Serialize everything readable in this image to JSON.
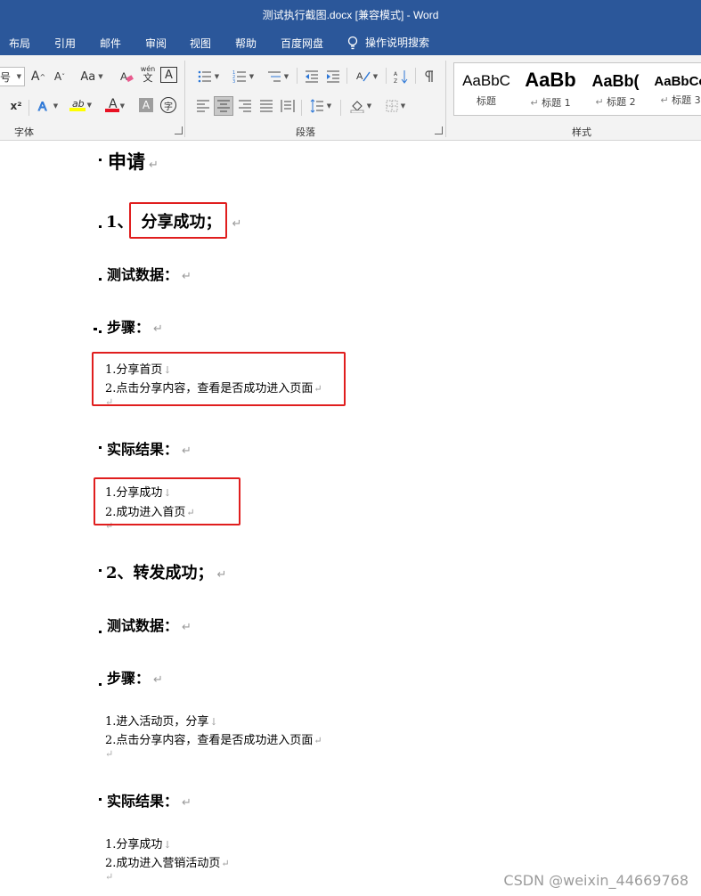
{
  "window": {
    "title": "测试执行截图.docx [兼容模式]  -  Word"
  },
  "menu": {
    "tabs": [
      "布局",
      "引用",
      "邮件",
      "审阅",
      "视图",
      "帮助",
      "百度网盘"
    ],
    "tell_me": "操作说明搜索"
  },
  "ribbon": {
    "font_size_value": "号",
    "grow_font": "A",
    "shrink_font": "A",
    "change_case": "Aa",
    "phonetic_top": "wén",
    "phonetic_bottom": "文",
    "border_char": "A",
    "superscript": "x²",
    "highlight": "ab",
    "font_color": "A",
    "shade_char": "A",
    "enclose_char": "字",
    "groups": {
      "font": "字体",
      "paragraph": "段落",
      "styles": "样式"
    },
    "styles": [
      {
        "sample": "AaBbC",
        "name": "标题"
      },
      {
        "sample": "AaBb",
        "name": "标题 1"
      },
      {
        "sample": "AaBb(",
        "name": "标题 2"
      },
      {
        "sample": "AaBbCo",
        "name": "标题 3"
      }
    ],
    "colors": {
      "highlight": "#ffff00",
      "font_color": "#e81123",
      "accent": "#2b579a"
    }
  },
  "document": {
    "apply": "申请",
    "section1": {
      "heading_num": "1、",
      "heading_text": "分享成功；",
      "test_data": "测试数据：",
      "steps_label": "步骤：",
      "steps": [
        "1.分享首页",
        "2.点击分享内容，查看是否成功进入页面"
      ],
      "result_label": "实际结果：",
      "results": [
        "1.分享成功",
        "2.成功进入首页"
      ]
    },
    "section2": {
      "heading": "2、转发成功；",
      "test_data": "测试数据：",
      "steps_label": "步骤：",
      "steps": [
        "1.进入活动页，分享",
        "2.点击分享内容，查看是否成功进入页面"
      ],
      "result_label": "实际结果：",
      "results": [
        "1.分享成功",
        "2.成功进入营销活动页"
      ]
    },
    "para_mark": "↵",
    "line_break": "↓"
  },
  "watermark": "CSDN @weixin_44669768"
}
